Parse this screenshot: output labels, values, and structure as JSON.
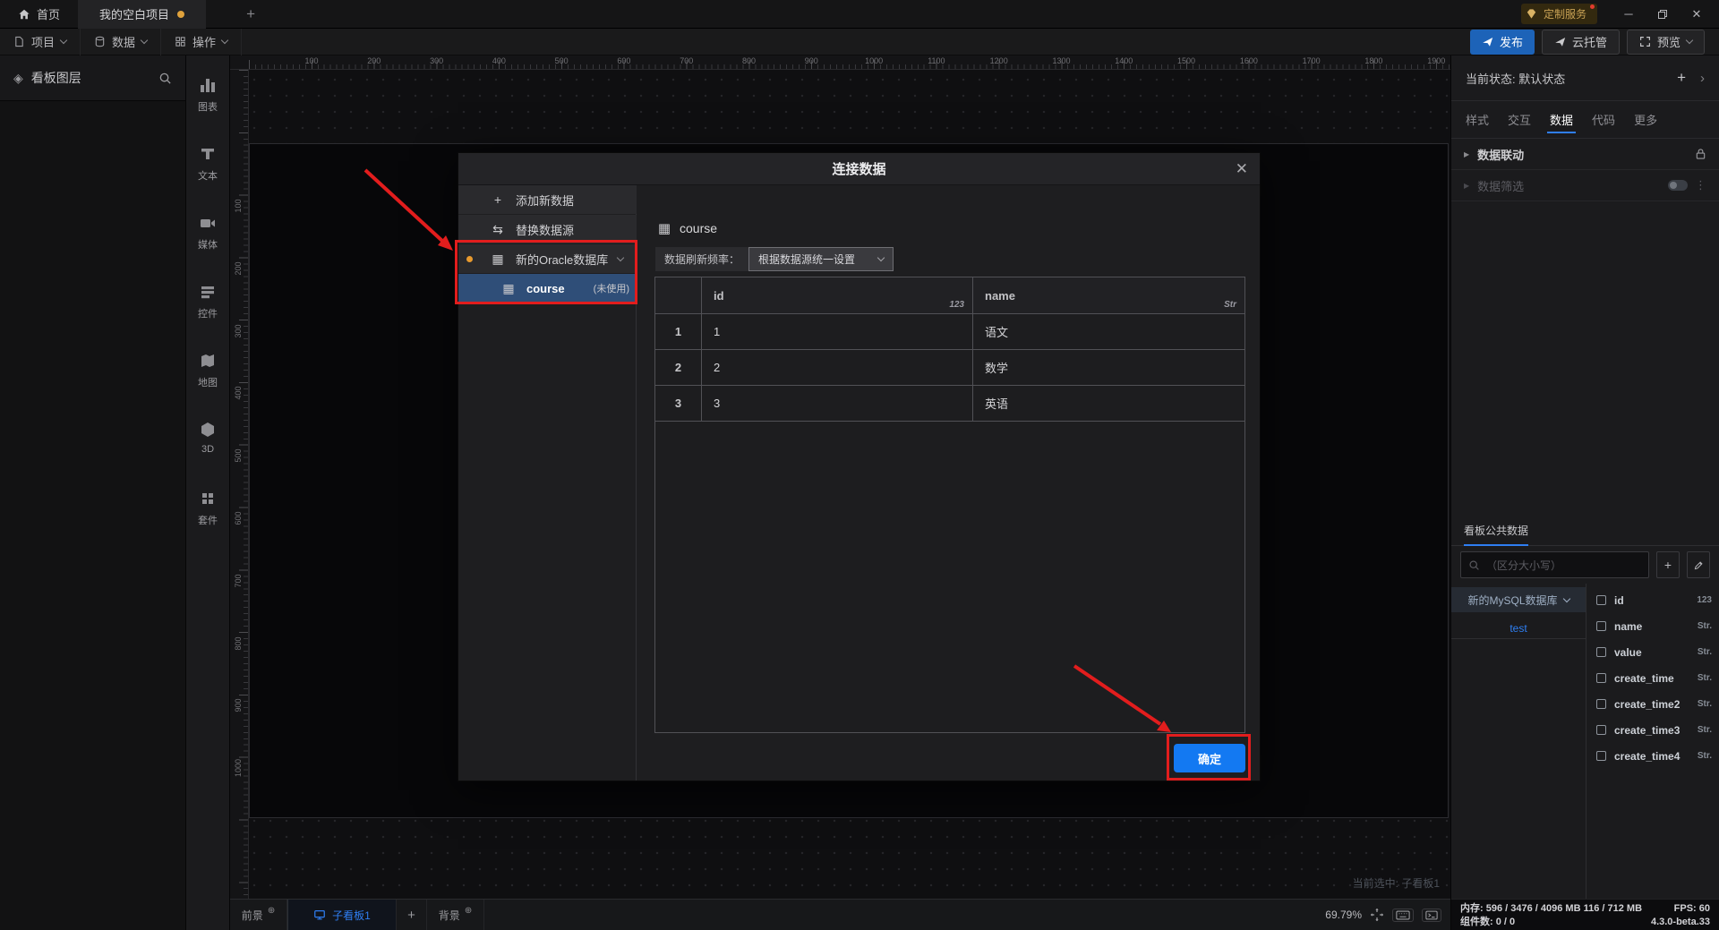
{
  "titlebar": {
    "home": "首页",
    "project": "我的空白项目",
    "vip": "定制服务"
  },
  "menubar": {
    "items": [
      "项目",
      "数据",
      "操作"
    ],
    "publish": "发布",
    "cloud": "云托管",
    "preview": "预览"
  },
  "left_panel": {
    "title": "看板图层"
  },
  "components": [
    {
      "key": "chart",
      "label": "图表",
      "icon": "bar-chart-icon"
    },
    {
      "key": "text",
      "label": "文本",
      "icon": "text-icon"
    },
    {
      "key": "media",
      "label": "媒体",
      "icon": "media-icon"
    },
    {
      "key": "control",
      "label": "控件",
      "icon": "widget-icon"
    },
    {
      "key": "map",
      "label": "地图",
      "icon": "map-icon"
    },
    {
      "key": "3d",
      "label": "3D",
      "icon": "cube-icon"
    },
    {
      "key": "kit",
      "label": "套件",
      "icon": "kit-icon"
    }
  ],
  "rulers": {
    "h_labels": [
      100,
      200,
      300,
      400,
      500,
      600,
      700,
      800,
      900,
      1000,
      1100,
      1200,
      1300,
      1400,
      1500,
      1600,
      1700,
      1800,
      1900
    ],
    "v_labels": [
      100,
      200,
      300,
      400,
      500,
      600,
      700,
      800,
      900,
      1000
    ]
  },
  "modal": {
    "title": "连接数据",
    "sidebar": {
      "add": "添加新数据",
      "replace": "替换数据源",
      "datasource": "新的Oracle数据库",
      "table": "course",
      "unused": "(未使用)"
    },
    "content": {
      "table_name": "course",
      "refresh_label": "数据刷新频率：",
      "refresh_value": "根据数据源统一设置",
      "ok": "确定"
    },
    "table": {
      "columns": [
        "id",
        "name"
      ],
      "col_types": [
        "123",
        "Str"
      ],
      "rows": [
        [
          "1",
          "1",
          "语文"
        ],
        [
          "2",
          "2",
          "数学"
        ],
        [
          "3",
          "3",
          "英语"
        ]
      ]
    }
  },
  "right_panel": {
    "state": "当前状态: 默认状态",
    "tabs": [
      "样式",
      "交互",
      "数据",
      "代码",
      "更多"
    ],
    "active_tab": "数据",
    "sec_linkage": "数据联动",
    "sec_filter": "数据筛选",
    "common": {
      "title": "看板公共数据",
      "search_placeholder": "（区分大小写）",
      "db": "新的MySQL数据库",
      "table": "test",
      "fields": [
        {
          "name": "id",
          "type": "123"
        },
        {
          "name": "name",
          "type": "Str."
        },
        {
          "name": "value",
          "type": "Str."
        },
        {
          "name": "create_time",
          "type": "Str."
        },
        {
          "name": "create_time2",
          "type": "Str."
        },
        {
          "name": "create_time3",
          "type": "Str."
        },
        {
          "name": "create_time4",
          "type": "Str."
        }
      ]
    }
  },
  "workspace": {
    "selected_hint": "当前选中: 子看板1"
  },
  "bottombar": {
    "foreground": "前景",
    "board": "子看板1",
    "background": "背景",
    "zoom": "69.79%",
    "mem_label": "内存:",
    "mem_value": "596 / 3476 / 4096 MB  116 / 712 MB",
    "fps": "FPS:  60",
    "components": "组件数: 0 / 0",
    "version": "4.3.0-beta.33"
  },
  "colors": {
    "accent_blue": "#1379f2",
    "publish_blue": "#1d63b8",
    "annotation_red": "#e21d1d",
    "warning_orange": "#e89a2e",
    "selected_row_blue": "#2f4e78"
  }
}
